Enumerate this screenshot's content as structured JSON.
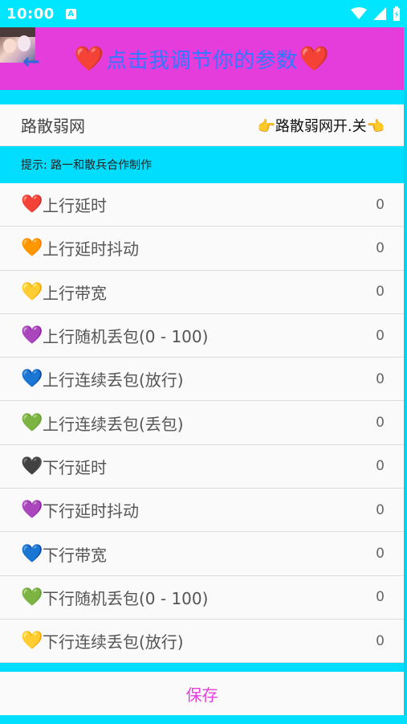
{
  "status_bar": {
    "time": "10:00",
    "icons": [
      "android-notification-icon",
      "wifi-icon",
      "signal-icon",
      "battery-icon"
    ]
  },
  "app_bar": {
    "title": "点击我调节你的参数",
    "heart": "❤️",
    "back_icon": "←"
  },
  "header": {
    "name": "路散弱网",
    "toggle_label": "👉路散弱网开.关👈"
  },
  "hint": "提示: 路一和散兵合作制作",
  "params": [
    {
      "heart": "❤️",
      "heart_color": "#e58d90",
      "label": "上行延时",
      "value": "0"
    },
    {
      "heart": "🧡",
      "heart_color": "#f4b26e",
      "label": "上行延时抖动",
      "value": "0"
    },
    {
      "heart": "💛",
      "heart_color": "#f6d96d",
      "label": "上行带宽",
      "value": "0"
    },
    {
      "heart": "💜",
      "heart_color": "#b57bd0",
      "label": "上行随机丢包(0 - 100)",
      "value": "0"
    },
    {
      "heart": "💙",
      "heart_color": "#7eb6ea",
      "label": "上行连续丢包(放行)",
      "value": "0"
    },
    {
      "heart": "💚",
      "heart_color": "#a4cf7d",
      "label": "上行连续丢包(丢包)",
      "value": "0"
    },
    {
      "heart": "🖤",
      "heart_color": "#767676",
      "label": "下行延时",
      "value": "0"
    },
    {
      "heart": "💜",
      "heart_color": "#b57bd0",
      "label": "下行延时抖动",
      "value": "0"
    },
    {
      "heart": "💙",
      "heart_color": "#7eb6ea",
      "label": "下行带宽",
      "value": "0"
    },
    {
      "heart": "💚",
      "heart_color": "#a4cf7d",
      "label": "下行随机丢包(0 - 100)",
      "value": "0"
    },
    {
      "heart": "💛",
      "heart_color": "#f6d96d",
      "label": "下行连续丢包(放行)",
      "value": "0"
    }
  ],
  "save_label": "保存",
  "colors": {
    "accent_magenta": "#e53ddc",
    "cyan": "#00e6ff",
    "title_blue": "#2f78ff"
  }
}
